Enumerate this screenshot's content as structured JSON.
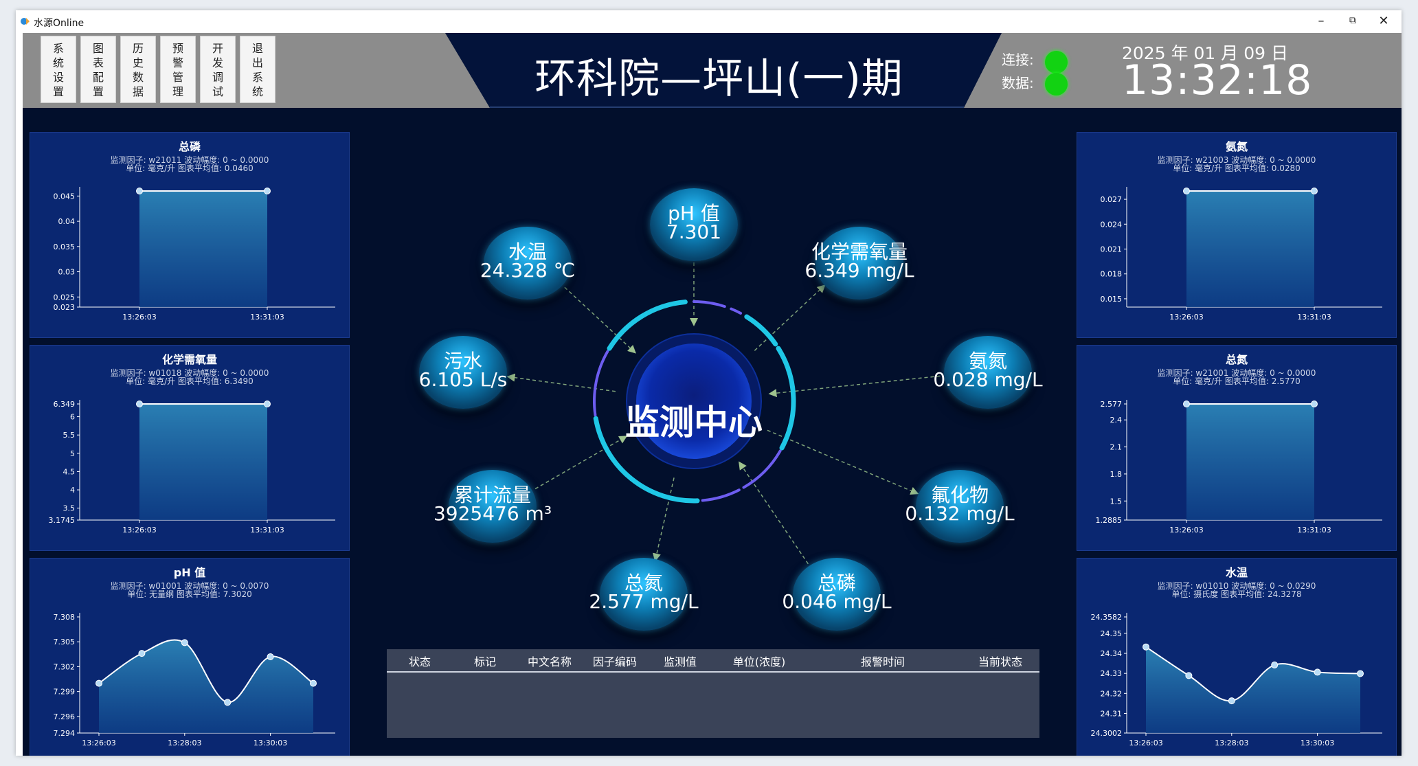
{
  "window": {
    "title": "水源Online",
    "controls": {
      "minimize": "–",
      "restore": "⧉",
      "close": "✕"
    }
  },
  "nav": {
    "buttons": [
      {
        "id": "settings",
        "chars": [
          "系",
          "统",
          "设",
          "置"
        ]
      },
      {
        "id": "chart-config",
        "chars": [
          "图",
          "表",
          "配",
          "置"
        ]
      },
      {
        "id": "history",
        "chars": [
          "历",
          "史",
          "数",
          "据"
        ]
      },
      {
        "id": "alarm-mgmt",
        "chars": [
          "预",
          "警",
          "管",
          "理"
        ]
      },
      {
        "id": "dev-debug",
        "chars": [
          "开",
          "发",
          "调",
          "试"
        ]
      },
      {
        "id": "exit",
        "chars": [
          "退",
          "出",
          "系",
          "统"
        ]
      }
    ]
  },
  "header": {
    "title": "环科院—坪山(一)期",
    "connection_label": "连接:",
    "data_label": "数据:",
    "connection_status": "#12d212",
    "data_status": "#12d212",
    "date": "2025 年 01 月 09 日",
    "time": "13:32:18"
  },
  "center": {
    "core_label": "监测中心",
    "nodes": [
      {
        "name": "pH 值",
        "value": "7.301"
      },
      {
        "name": "化学需氧量",
        "value": "6.349 mg/L"
      },
      {
        "name": "氨氮",
        "value": "0.028 mg/L"
      },
      {
        "name": "氟化物",
        "value": "0.132 mg/L"
      },
      {
        "name": "总磷",
        "value": "0.046 mg/L"
      },
      {
        "name": "总氮",
        "value": "2.577 mg/L"
      },
      {
        "name": "累计流量",
        "value": "3925476 m³"
      },
      {
        "name": "污水",
        "value": "6.105 L/s"
      },
      {
        "name": "水温",
        "value": "24.328 ℃"
      }
    ]
  },
  "alarm_table": {
    "columns": [
      "状态",
      "标记",
      "中文名称",
      "因子编码",
      "监测值",
      "单位(浓度)",
      "报警时间",
      "当前状态"
    ],
    "rows": []
  },
  "colors": {
    "background": "#020f2c",
    "panel": "#0a2771",
    "accent": "#1fc7e6",
    "line": "#ffffff",
    "led": "#12d212"
  },
  "chart_data": [
    {
      "panel": "left-1",
      "type": "area",
      "title": "总磷",
      "info1": "监测因子: w21011   波动幅度: 0 ~ 0.0000",
      "info2": "单位: 毫克/升   图表平均值: 0.0460",
      "x": [
        "13:26:03",
        "13:31:03"
      ],
      "y": [
        0.046,
        0.046
      ],
      "ylim": [
        0.023,
        0.046
      ],
      "yticks": [
        "0.045",
        "0.04",
        "0.035",
        "0.03",
        "0.025",
        "0.023"
      ],
      "ytick_values": [
        0.045,
        0.04,
        0.035,
        0.03,
        0.025,
        0.023
      ]
    },
    {
      "panel": "left-2",
      "type": "area",
      "title": "化学需氧量",
      "info1": "监测因子: w01018   波动幅度: 0 ~ 0.0000",
      "info2": "单位: 毫克/升   图表平均值: 6.3490",
      "x": [
        "13:26:03",
        "13:31:03"
      ],
      "y": [
        6.349,
        6.349
      ],
      "ylim": [
        3.1745,
        6.349
      ],
      "yticks": [
        "6.349",
        "6",
        "5.5",
        "5",
        "4.5",
        "4",
        "3.5",
        "3.1745"
      ],
      "ytick_values": [
        6.349,
        6,
        5.5,
        5,
        4.5,
        4,
        3.5,
        3.1745
      ]
    },
    {
      "panel": "left-3",
      "type": "area",
      "title": "pH 值",
      "info1": "监测因子: w01001   波动幅度: 0 ~ 0.0070",
      "info2": "单位: 无量纲   图表平均值: 7.3020",
      "x": [
        "13:26:03",
        "13:27:03",
        "13:28:03",
        "13:29:03",
        "13:30:03",
        "13:31:03"
      ],
      "xticks": [
        "13:26:03",
        "13:28:03",
        "13:30:03"
      ],
      "y": [
        7.3,
        7.3036,
        7.3049,
        7.2977,
        7.3032,
        7.3
      ],
      "ylim": [
        7.294,
        7.308
      ],
      "yticks": [
        "7.308",
        "7.305",
        "7.302",
        "7.299",
        "7.296",
        "7.294"
      ],
      "ytick_values": [
        7.308,
        7.305,
        7.302,
        7.299,
        7.296,
        7.294
      ]
    },
    {
      "panel": "right-1",
      "type": "area",
      "title": "氨氮",
      "info1": "监测因子: w21003   波动幅度: 0 ~ 0.0000",
      "info2": "单位: 毫克/升   图表平均值: 0.0280",
      "x": [
        "13:26:03",
        "13:31:03"
      ],
      "y": [
        0.028,
        0.028
      ],
      "ylim": [
        0.014,
        0.028
      ],
      "yticks": [
        "0.027",
        "0.024",
        "0.021",
        "0.018",
        "0.015"
      ],
      "ytick_values": [
        0.027,
        0.024,
        0.021,
        0.018,
        0.015
      ]
    },
    {
      "panel": "right-2",
      "type": "area",
      "title": "总氮",
      "info1": "监测因子: w21001   波动幅度: 0 ~ 0.0000",
      "info2": "单位: 毫克/升   图表平均值: 2.5770",
      "x": [
        "13:26:03",
        "13:31:03"
      ],
      "y": [
        2.577,
        2.577
      ],
      "ylim": [
        1.2885,
        2.577
      ],
      "yticks": [
        "2.577",
        "2.4",
        "2.1",
        "1.8",
        "1.5",
        "1.2885"
      ],
      "ytick_values": [
        2.577,
        2.4,
        2.1,
        1.8,
        1.5,
        1.2885
      ]
    },
    {
      "panel": "right-3",
      "type": "area",
      "title": "水温",
      "info1": "监测因子: w01010   波动幅度: 0 ~ 0.0290",
      "info2": "单位: 摄氏度   图表平均值: 24.3278",
      "x": [
        "13:26:03",
        "13:27:03",
        "13:28:03",
        "13:29:03",
        "13:30:03",
        "13:31:03"
      ],
      "xticks": [
        "13:26:03",
        "13:28:03",
        "13:30:03"
      ],
      "y": [
        24.3432,
        24.3289,
        24.3163,
        24.3342,
        24.3306,
        24.3299
      ],
      "ylim": [
        24.3002,
        24.3582
      ],
      "yticks": [
        "24.3582",
        "24.35",
        "24.34",
        "24.33",
        "24.32",
        "24.31",
        "24.3002"
      ],
      "ytick_values": [
        24.3582,
        24.35,
        24.34,
        24.33,
        24.32,
        24.31,
        24.3002
      ]
    }
  ]
}
